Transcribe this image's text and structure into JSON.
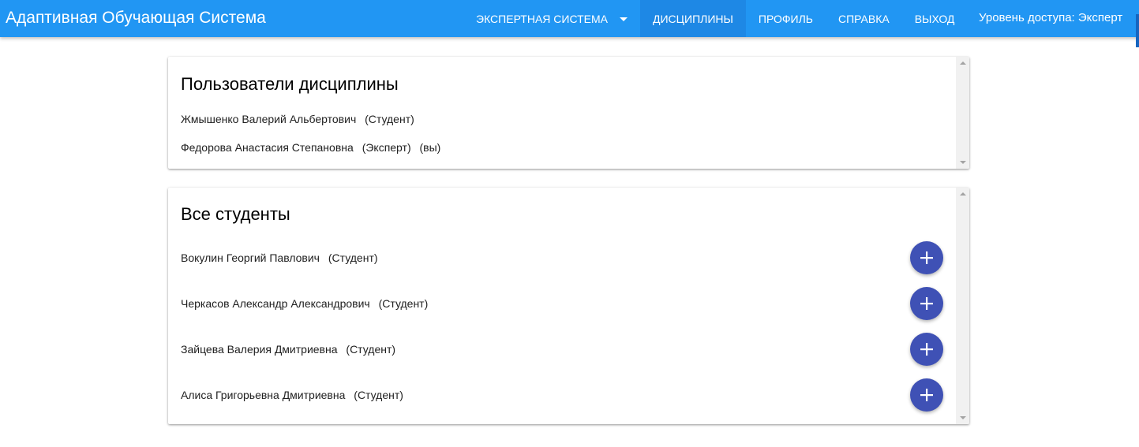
{
  "header": {
    "app_title": "Адаптивная Обучающая Система",
    "nav": [
      {
        "label": "Экспертная система",
        "has_dropdown": true,
        "active": false
      },
      {
        "label": "Дисциплины",
        "active": true
      },
      {
        "label": "Профиль",
        "active": false
      },
      {
        "label": "Справка",
        "active": false
      },
      {
        "label": "Выход",
        "active": false
      }
    ],
    "access_level": "Уровень доступа: Эксперт"
  },
  "discipline_users": {
    "title": "Пользователи дисциплины",
    "rows": [
      {
        "name": "Жмышенко Валерий Альбертович",
        "role": "(Студент)",
        "note": ""
      },
      {
        "name": "Федорова Анастасия Степановна",
        "role": "(Эксперт)",
        "note": "(вы)"
      }
    ]
  },
  "all_students": {
    "title": "Все студенты",
    "rows": [
      {
        "name": "Вокулин Георгий Павлович",
        "role": "(Студент)",
        "action_icon": "add-icon"
      },
      {
        "name": "Черкасов Александр Александрович",
        "role": "(Студент)",
        "action_icon": "add-icon"
      },
      {
        "name": "Зайцева Валерия Дмитриевна",
        "role": "(Студент)",
        "action_icon": "add-icon"
      },
      {
        "name": "Алиса Григорьевна Дмитриевна",
        "role": "(Студент)",
        "action_icon": "add-icon"
      }
    ]
  },
  "colors": {
    "app_bar": "#2196f3",
    "active_tab": "#1e88e5",
    "add_button": "#3f51b5"
  }
}
